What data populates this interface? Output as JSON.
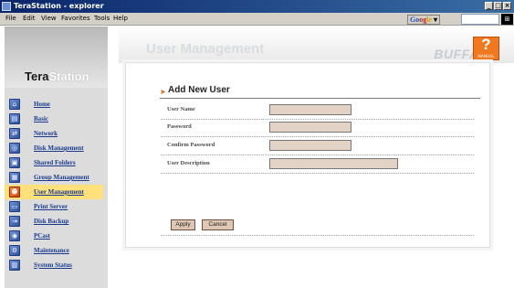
{
  "window": {
    "title": "TeraStation - explorer"
  },
  "menu": {
    "items": [
      "File",
      "Edit",
      "View",
      "Favorites",
      "Tools",
      "Help"
    ]
  },
  "toolbar": {
    "google_logo": [
      "Go",
      "og",
      "le"
    ],
    "search_value": ""
  },
  "brand": {
    "logo_main": "Tera",
    "logo_accent": "Station",
    "company": "BUFFALO"
  },
  "page": {
    "title": "User Management",
    "help_label": "MANUAL"
  },
  "sidebar": {
    "active_index": 6,
    "items": [
      {
        "label": "Home",
        "icon": "home-icon"
      },
      {
        "label": "Basic",
        "icon": "basic-icon"
      },
      {
        "label": "Network",
        "icon": "network-icon"
      },
      {
        "label": "Disk Management",
        "icon": "disk-icon"
      },
      {
        "label": "Shared Folders",
        "icon": "folder-icon"
      },
      {
        "label": "Group Management",
        "icon": "group-icon"
      },
      {
        "label": "User Management",
        "icon": "user-icon"
      },
      {
        "label": "Print Server",
        "icon": "printer-icon"
      },
      {
        "label": "Disk Backup",
        "icon": "backup-icon"
      },
      {
        "label": "PCast",
        "icon": "pcast-icon"
      },
      {
        "label": "Maintenance",
        "icon": "maintenance-icon"
      },
      {
        "label": "System Status",
        "icon": "status-icon"
      }
    ]
  },
  "form": {
    "section_title": "Add New User",
    "fields": [
      {
        "label": "User Name",
        "value": ""
      },
      {
        "label": "Password",
        "value": ""
      },
      {
        "label": "Confirm Password",
        "value": ""
      },
      {
        "label": "User Description",
        "value": ""
      }
    ],
    "apply_label": "Apply",
    "cancel_label": "Cancel"
  },
  "colors": {
    "accent": "#f0781e",
    "nav_link": "#1a3a8f",
    "active_nav": "#ffe07a",
    "input_bg": "#e3d3c6"
  }
}
